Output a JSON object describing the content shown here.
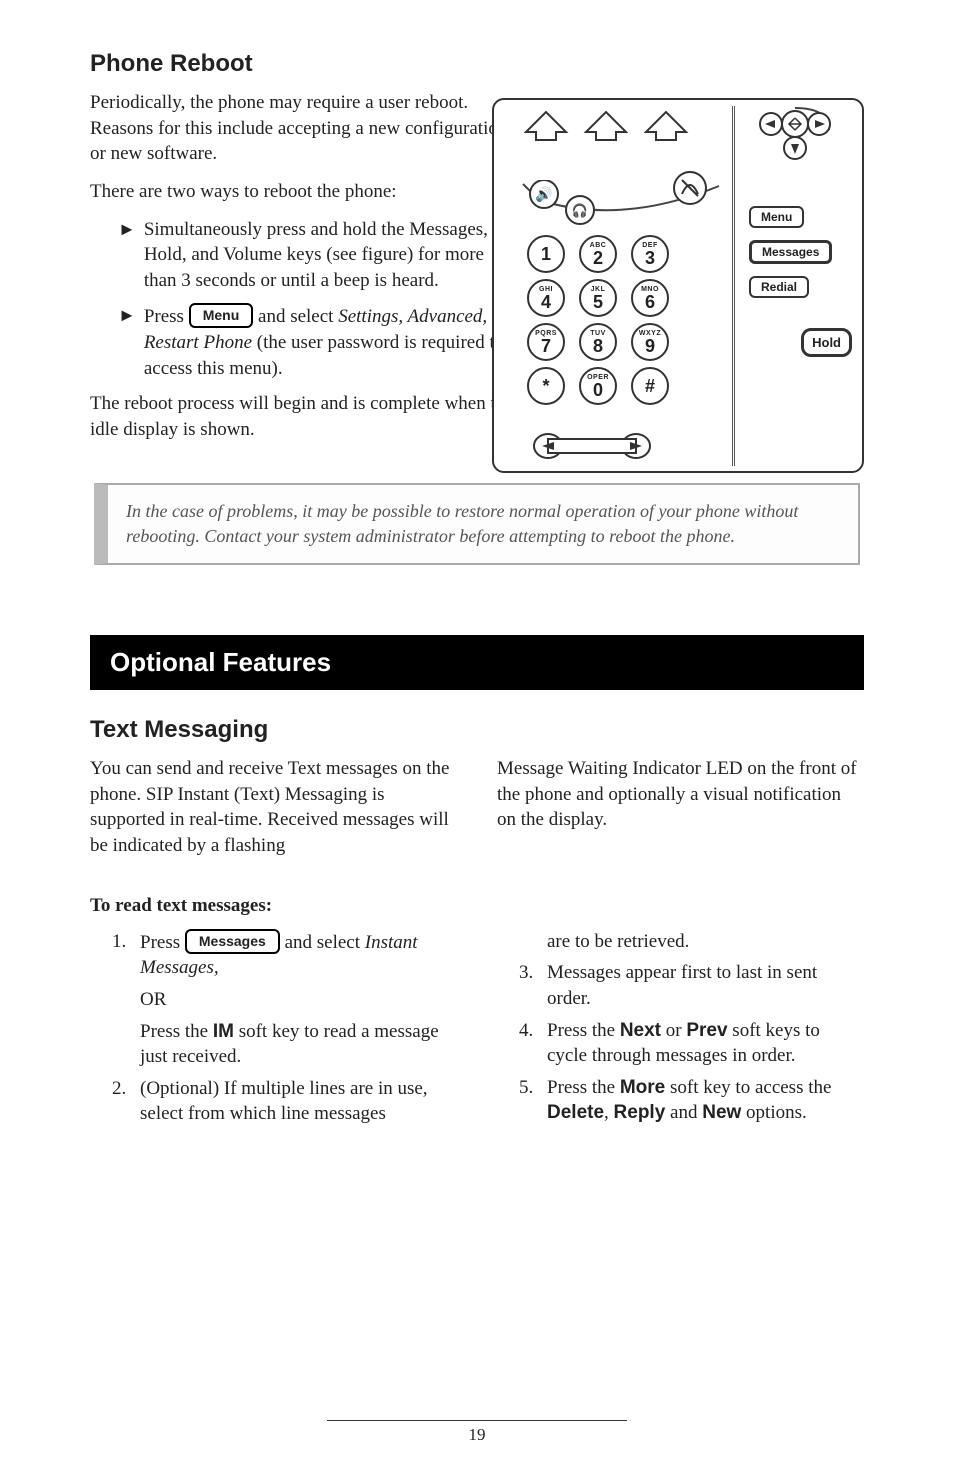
{
  "section1": {
    "title": "Phone Reboot",
    "p1": "Periodically, the phone may require a user reboot.  Reasons for this include accepting a new configuration or new software.",
    "p2": "There are two ways to reboot the phone:",
    "bullet1": "Simultaneously press and hold the Messages, Hold, and Volume keys (see figure) for more than 3 seconds or until a beep is heard.",
    "bullet2_pre": "Press ",
    "bullet2_btn": "Menu",
    "bullet2_mid": " and select ",
    "bullet2_italic": "Settings, Advanced, Restart Phone",
    "bullet2_post": " (the user password is required to access this menu).",
    "p3": "The reboot process will begin and is complete when the idle display is shown.",
    "note": "In the case of problems, it may be possible to restore normal operation of your phone without rebooting.  Contact your system administrator before attempting to reboot the phone."
  },
  "bigheader": "Optional Features",
  "section2": {
    "title": "Text Messaging",
    "left_p": "You can send and receive Text messages on the phone.  SIP Instant (Text) Messaging is supported in real-time.  Received messages will be indicated by a flashing",
    "right_p": "Message Waiting Indicator LED on the front of the phone and optionally a visual notification on the display.",
    "subhead": "To read text messages:",
    "li1_pre": "Press ",
    "li1_btn": "Messages",
    "li1_mid": " and select ",
    "li1_italic": "Instant Messages,",
    "li1_or": "OR",
    "li1_press_the": "Press the ",
    "li1_im": "IM",
    "li1_post": " soft key to read a message just received.",
    "li2": "(Optional)  If multiple lines are in use, select from which line messages",
    "r_cont": "are to be retrieved.",
    "li3": "Messages appear first to last in sent order.",
    "li4_pre": "Press the ",
    "li4_next": "Next",
    "li4_or": " or ",
    "li4_prev": "Prev",
    "li4_post": " soft keys to cycle through messages in order.",
    "li5_pre": "Press the ",
    "li5_more": "More",
    "li5_mid": " soft key to access the ",
    "li5_del": "Delete",
    "li5_c1": ", ",
    "li5_reply": "Reply",
    "li5_and": " and ",
    "li5_new": "New",
    "li5_post": " options."
  },
  "phone": {
    "menu": "Menu",
    "messages": "Messages",
    "redial": "Redial",
    "hold": "Hold",
    "keys": [
      [
        "",
        "1"
      ],
      [
        "ABC",
        "2"
      ],
      [
        "DEF",
        "3"
      ],
      [
        "GHI",
        "4"
      ],
      [
        "JKL",
        "5"
      ],
      [
        "MNO",
        "6"
      ],
      [
        "PQRS",
        "7"
      ],
      [
        "TUV",
        "8"
      ],
      [
        "WXYZ",
        "9"
      ],
      [
        "",
        "*"
      ],
      [
        "OPER",
        "0"
      ],
      [
        "",
        "#"
      ]
    ]
  },
  "page_number": "19"
}
